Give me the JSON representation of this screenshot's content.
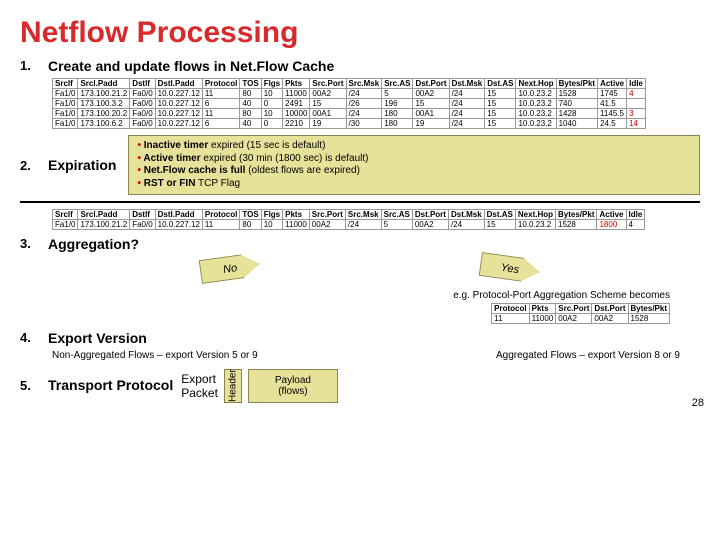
{
  "title": "Netflow Processing",
  "steps": {
    "s1": {
      "num": "1.",
      "label": "Create and update flows in Net.Flow Cache"
    },
    "s2": {
      "num": "2.",
      "label": "Expiration"
    },
    "s3": {
      "num": "3.",
      "label": "Aggregation?"
    },
    "s4": {
      "num": "4.",
      "label": "Export Version"
    },
    "s5": {
      "num": "5.",
      "label": "Transport Protocol"
    }
  },
  "table_headers": [
    "Srclf",
    "Srcl.Padd",
    "Dstlf",
    "Dstl.Padd",
    "Protocol",
    "TOS",
    "Flgs",
    "Pkts",
    "Src.Port",
    "Src.Msk",
    "Src.AS",
    "Dst.Port",
    "Dst.Msk",
    "Dst.AS",
    "Next.Hop",
    "Bytes/Pkt",
    "Active",
    "Idle"
  ],
  "table1_rows": [
    [
      "Fa1/0",
      "173.100.21.2",
      "Fa0/0",
      "10.0.227.12",
      "11",
      "80",
      "10",
      "11000",
      "00A2",
      "/24",
      "5",
      "00A2",
      "/24",
      "15",
      "10.0.23.2",
      "1528",
      "1745",
      "4"
    ],
    [
      "Fa1/0",
      "173.100.3.2",
      "Fa0/0",
      "10.0.227.12",
      "6",
      "40",
      "0",
      "2491",
      "15",
      "/26",
      "196",
      "15",
      "/24",
      "15",
      "10.0.23.2",
      "740",
      "41.5",
      ""
    ],
    [
      "Fa1/0",
      "173.100.20.2",
      "Fa0/0",
      "10.0.227.12",
      "11",
      "80",
      "10",
      "10000",
      "00A1",
      "/24",
      "180",
      "00A1",
      "/24",
      "15",
      "10.0.23.2",
      "1428",
      "1145.5",
      "3"
    ],
    [
      "Fa1/0",
      "173.100.6.2",
      "Fa0/0",
      "10.0.227.12",
      "6",
      "40",
      "0",
      "2210",
      "19",
      "/30",
      "180",
      "19",
      "/24",
      "15",
      "10.0.23.2",
      "1040",
      "24.5",
      "14"
    ]
  ],
  "expiration_notes": [
    "Inactive timer expired (15 sec is default)",
    "Active timer expired (30 min (1800 sec) is default)",
    "Net.Flow cache is full (oldest flows are expired)",
    "RST or FIN TCP Flag"
  ],
  "table2_rows": [
    [
      "Fa1/0",
      "173.100.21.2",
      "Fa0/0",
      "10.0.227.12",
      "11",
      "80",
      "10",
      "11000",
      "00A2",
      "/24",
      "5",
      "00A2",
      "/24",
      "15",
      "10.0.23.2",
      "1528",
      "1800",
      "4"
    ]
  ],
  "arrows": {
    "no": "No",
    "yes": "Yes"
  },
  "agg_caption": "e.g. Protocol-Port Aggregation Scheme becomes",
  "agg_headers": [
    "Protocol",
    "Pkts",
    "Src.Port",
    "Dst.Port",
    "Bytes/Pkt"
  ],
  "agg_row": [
    "11",
    "11000",
    "00A2",
    "00A2",
    "1528"
  ],
  "export_notes": {
    "left": "Non-Aggregated Flows – export Version 5 or 9",
    "right": "Aggregated Flows – export Version 8 or 9"
  },
  "transport": {
    "export_label": "Export\nPacket",
    "header": "Header",
    "payload1": "Payload",
    "payload2": "(flows)"
  },
  "page_number": "28"
}
